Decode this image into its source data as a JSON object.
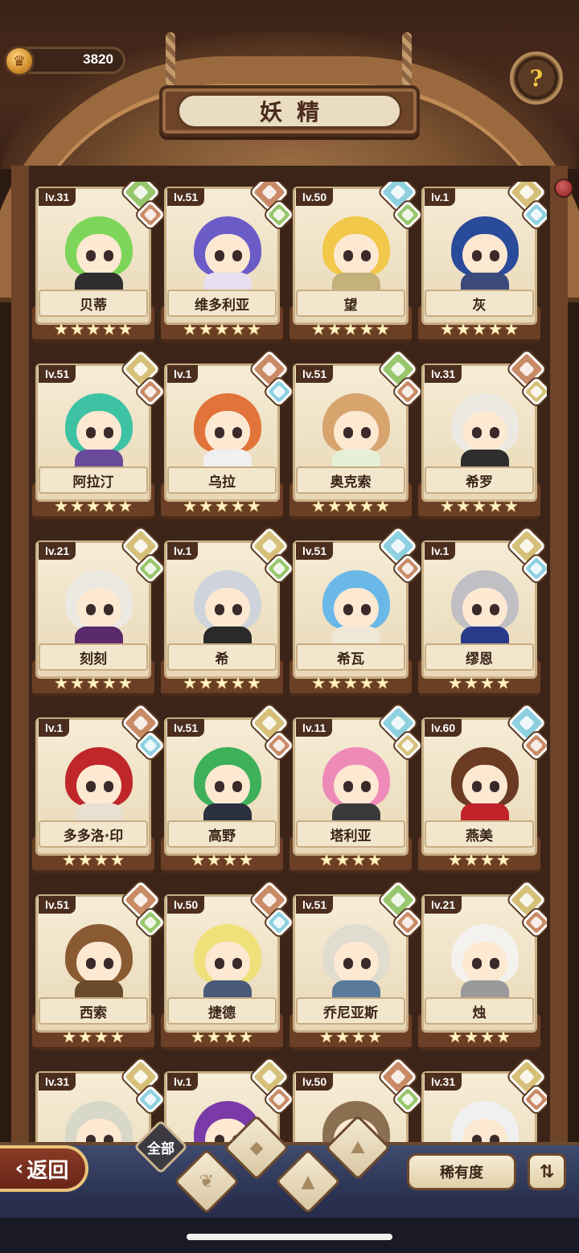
{
  "header": {
    "title": "妖精",
    "currency_value": "3820",
    "help_icon": "question-sprout-icon"
  },
  "colors": {
    "earth": "#d6c079",
    "water": "#8ed0e0",
    "fire": "#c98a66",
    "wood": "#98c66c"
  },
  "cards": [
    {
      "level": "lv.31",
      "name": "贝蒂",
      "stars": 5,
      "hair": "#7dd65a",
      "body": "#2e2e2e",
      "elements": [
        "wood",
        "fire"
      ]
    },
    {
      "level": "lv.51",
      "name": "维多利亚",
      "stars": 5,
      "hair": "#6b5cc8",
      "body": "#e8e0f0",
      "elements": [
        "fire",
        "wood"
      ]
    },
    {
      "level": "lv.50",
      "name": "望",
      "stars": 5,
      "hair": "#f2c84a",
      "body": "#c4b27a",
      "elements": [
        "water",
        "wood"
      ]
    },
    {
      "level": "lv.1",
      "name": "灰",
      "stars": 5,
      "hair": "#2a4a9a",
      "body": "#3b4a7a",
      "elements": [
        "earth",
        "water"
      ]
    },
    {
      "level": "lv.51",
      "name": "阿拉汀",
      "stars": 5,
      "hair": "#3ec2a4",
      "body": "#6a4a9a",
      "elements": [
        "earth",
        "fire"
      ]
    },
    {
      "level": "lv.1",
      "name": "乌拉",
      "stars": 5,
      "hair": "#e2733a",
      "body": "#f0f0f0",
      "elements": [
        "fire",
        "water"
      ]
    },
    {
      "level": "lv.51",
      "name": "奥克索",
      "stars": 5,
      "hair": "#d8a46e",
      "body": "#e6f0d6",
      "elements": [
        "wood",
        "fire"
      ]
    },
    {
      "level": "lv.31",
      "name": "希罗",
      "stars": 5,
      "hair": "#ece8e2",
      "body": "#2e2e2e",
      "elements": [
        "fire",
        "earth"
      ]
    },
    {
      "level": "lv.21",
      "name": "刻刻",
      "stars": 5,
      "hair": "#ece8e2",
      "body": "#5a2a6a",
      "elements": [
        "earth",
        "wood"
      ]
    },
    {
      "level": "lv.1",
      "name": "希",
      "stars": 5,
      "hair": "#cfd4dc",
      "body": "#2a2a2a",
      "elements": [
        "earth",
        "wood"
      ]
    },
    {
      "level": "lv.51",
      "name": "希瓦",
      "stars": 5,
      "hair": "#6ab8e8",
      "body": "#f0e8d6",
      "elements": [
        "water",
        "fire"
      ]
    },
    {
      "level": "lv.1",
      "name": "缪恩",
      "stars": 4,
      "hair": "#c0c0c4",
      "body": "#2a3a8a",
      "elements": [
        "earth",
        "water"
      ]
    },
    {
      "level": "lv.1",
      "name": "多多洛·印",
      "stars": 4,
      "hair": "#c0262a",
      "body": "#e8e0d0",
      "elements": [
        "fire",
        "water"
      ]
    },
    {
      "level": "lv.51",
      "name": "高野",
      "stars": 4,
      "hair": "#3eb05a",
      "body": "#2a3040",
      "elements": [
        "earth",
        "fire"
      ]
    },
    {
      "level": "lv.11",
      "name": "塔利亚",
      "stars": 4,
      "hair": "#ee8ab8",
      "body": "#3a3a3a",
      "elements": [
        "water",
        "earth"
      ]
    },
    {
      "level": "lv.60",
      "name": "燕美",
      "stars": 4,
      "hair": "#6a3a22",
      "body": "#c0242a",
      "elements": [
        "water",
        "fire"
      ]
    },
    {
      "level": "lv.51",
      "name": "西索",
      "stars": 4,
      "hair": "#8a5a32",
      "body": "#6a4a2a",
      "elements": [
        "fire",
        "wood"
      ]
    },
    {
      "level": "lv.50",
      "name": "捷德",
      "stars": 4,
      "hair": "#f0e07a",
      "body": "#4a5a7a",
      "elements": [
        "fire",
        "water"
      ]
    },
    {
      "level": "lv.51",
      "name": "乔尼亚斯",
      "stars": 4,
      "hair": "#e0dccf",
      "body": "#5a7a9a",
      "elements": [
        "wood",
        "fire"
      ]
    },
    {
      "level": "lv.21",
      "name": "烛",
      "stars": 4,
      "hair": "#f4f2ee",
      "body": "#9a9a9a",
      "elements": [
        "earth",
        "fire"
      ]
    },
    {
      "level": "lv.31",
      "name": "",
      "stars": 0,
      "hair": "#d8d8c8",
      "body": "#9ab4c8",
      "elements": [
        "earth",
        "water"
      ]
    },
    {
      "level": "lv.1",
      "name": "",
      "stars": 0,
      "hair": "#7a3aa8",
      "body": "#f0d070",
      "elements": [
        "earth",
        "fire"
      ]
    },
    {
      "level": "lv.50",
      "name": "",
      "stars": 0,
      "hair": "#8a7050",
      "body": "#e0e0d8",
      "elements": [
        "fire",
        "wood"
      ]
    },
    {
      "level": "lv.31",
      "name": "",
      "stars": 0,
      "hair": "#f0f0f0",
      "body": "#3a3a8a",
      "elements": [
        "earth",
        "fire"
      ]
    }
  ],
  "footer": {
    "back_label": "返回",
    "all_tab_label": "全部",
    "rarity_label": "稀有度",
    "filter_tabs": [
      "wood-filter-icon",
      "water-filter-icon",
      "earth-filter-icon",
      "fire-filter-icon"
    ],
    "sort_icon": "sort-icon"
  }
}
